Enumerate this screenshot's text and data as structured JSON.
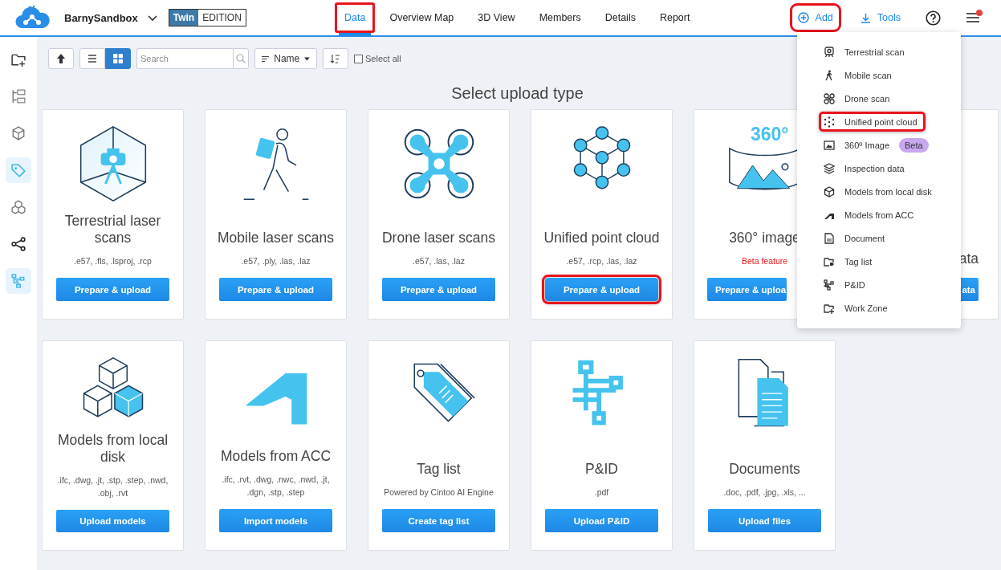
{
  "header": {
    "workspace": "BarnySandbox",
    "edition": {
      "brand": "Twin",
      "label": "EDITION"
    },
    "tabs": [
      {
        "label": "Data",
        "selected": true,
        "highlighted": true
      },
      {
        "label": "Overview Map",
        "selected": false,
        "highlighted": false
      },
      {
        "label": "3D View",
        "selected": false,
        "highlighted": false
      },
      {
        "label": "Members",
        "selected": false,
        "highlighted": false
      },
      {
        "label": "Details",
        "selected": false,
        "highlighted": false
      },
      {
        "label": "Report",
        "selected": false,
        "highlighted": false
      }
    ],
    "add_button": {
      "label": "Add",
      "highlighted": true
    },
    "tools_button": {
      "label": "Tools"
    },
    "notification": true
  },
  "sidebar": {
    "items": [
      {
        "selected": false
      },
      {
        "selected": false
      },
      {
        "selected": false
      },
      {
        "selected": true
      },
      {
        "selected": false
      },
      {
        "selected": false
      },
      {
        "selected": true
      }
    ]
  },
  "toolbar": {
    "views": [
      {
        "selected": false
      },
      {
        "selected": true
      }
    ],
    "search": {
      "placeholder": "Search"
    },
    "sort": {
      "label": "Name"
    },
    "select_all": {
      "label": "Select all",
      "checked": false
    }
  },
  "page_title": "Select upload type",
  "cards": [
    {
      "kind": "full",
      "title": "Terrestrial laser scans",
      "subtitle": ".e57, .fls, .lsproj, .rcp",
      "beta": false,
      "button": "Prepare & upload",
      "highlighted": false
    },
    {
      "kind": "full",
      "title": "Mobile laser scans",
      "subtitle": ".e57, .ply, .las, .laz",
      "beta": false,
      "button": "Prepare & upload",
      "highlighted": false
    },
    {
      "kind": "full",
      "title": "Drone laser scans",
      "subtitle": ".e57, .las, .laz",
      "beta": false,
      "button": "Prepare & upload",
      "highlighted": false
    },
    {
      "kind": "full",
      "title": "Unified point cloud",
      "subtitle": ".e57, .rcp, .las, .laz",
      "beta": false,
      "button": "Prepare & upload",
      "highlighted": true
    },
    {
      "kind": "cut-right",
      "title": "360° image",
      "subtitle": "Beta feature",
      "beta": true,
      "button": "Prepare & uploa",
      "highlighted": false,
      "artwork_label": "360°"
    },
    {
      "kind": "cut-left",
      "title": "ata",
      "button": "ata",
      "highlighted": false
    },
    {
      "kind": "full",
      "title": "Models from local disk",
      "subtitle": ".ifc, .dwg, .jt, .stp, .step, .nwd, .obj, .rvt",
      "beta": false,
      "button": "Upload models",
      "highlighted": false
    },
    {
      "kind": "full",
      "title": "Models from ACC",
      "subtitle": ".ifc, .rvt, .dwg, .nwc, .nwd, .jt, .dgn, .stp, .step",
      "beta": false,
      "button": "Import models",
      "highlighted": false
    },
    {
      "kind": "full",
      "title": "Tag list",
      "subtitle": "Powered by Cintoo AI Engine",
      "beta": false,
      "button": "Create tag list",
      "highlighted": false
    },
    {
      "kind": "full",
      "title": "P&ID",
      "subtitle": ".pdf",
      "beta": false,
      "button": "Upload P&ID",
      "highlighted": false
    },
    {
      "kind": "full",
      "title": "Documents",
      "subtitle": ".doc, .pdf, .jpg, .xls, ...",
      "beta": false,
      "button": "Upload files",
      "highlighted": false
    }
  ],
  "add_menu": {
    "items": [
      {
        "label": "Terrestrial scan",
        "highlighted": false
      },
      {
        "label": "Mobile scan",
        "highlighted": false
      },
      {
        "label": "Drone scan",
        "highlighted": false
      },
      {
        "label": "Unified point cloud",
        "highlighted": true
      },
      {
        "label": "360º Image",
        "badge": "Beta",
        "highlighted": false
      },
      {
        "label": "Inspection data",
        "highlighted": false
      },
      {
        "label": "Models from local disk",
        "highlighted": false
      },
      {
        "label": "Models from ACC",
        "highlighted": false
      },
      {
        "label": "Document",
        "highlighted": false
      },
      {
        "label": "Tag list",
        "highlighted": false
      },
      {
        "label": "P&ID",
        "highlighted": false
      },
      {
        "label": "Work Zone",
        "highlighted": false
      }
    ]
  }
}
